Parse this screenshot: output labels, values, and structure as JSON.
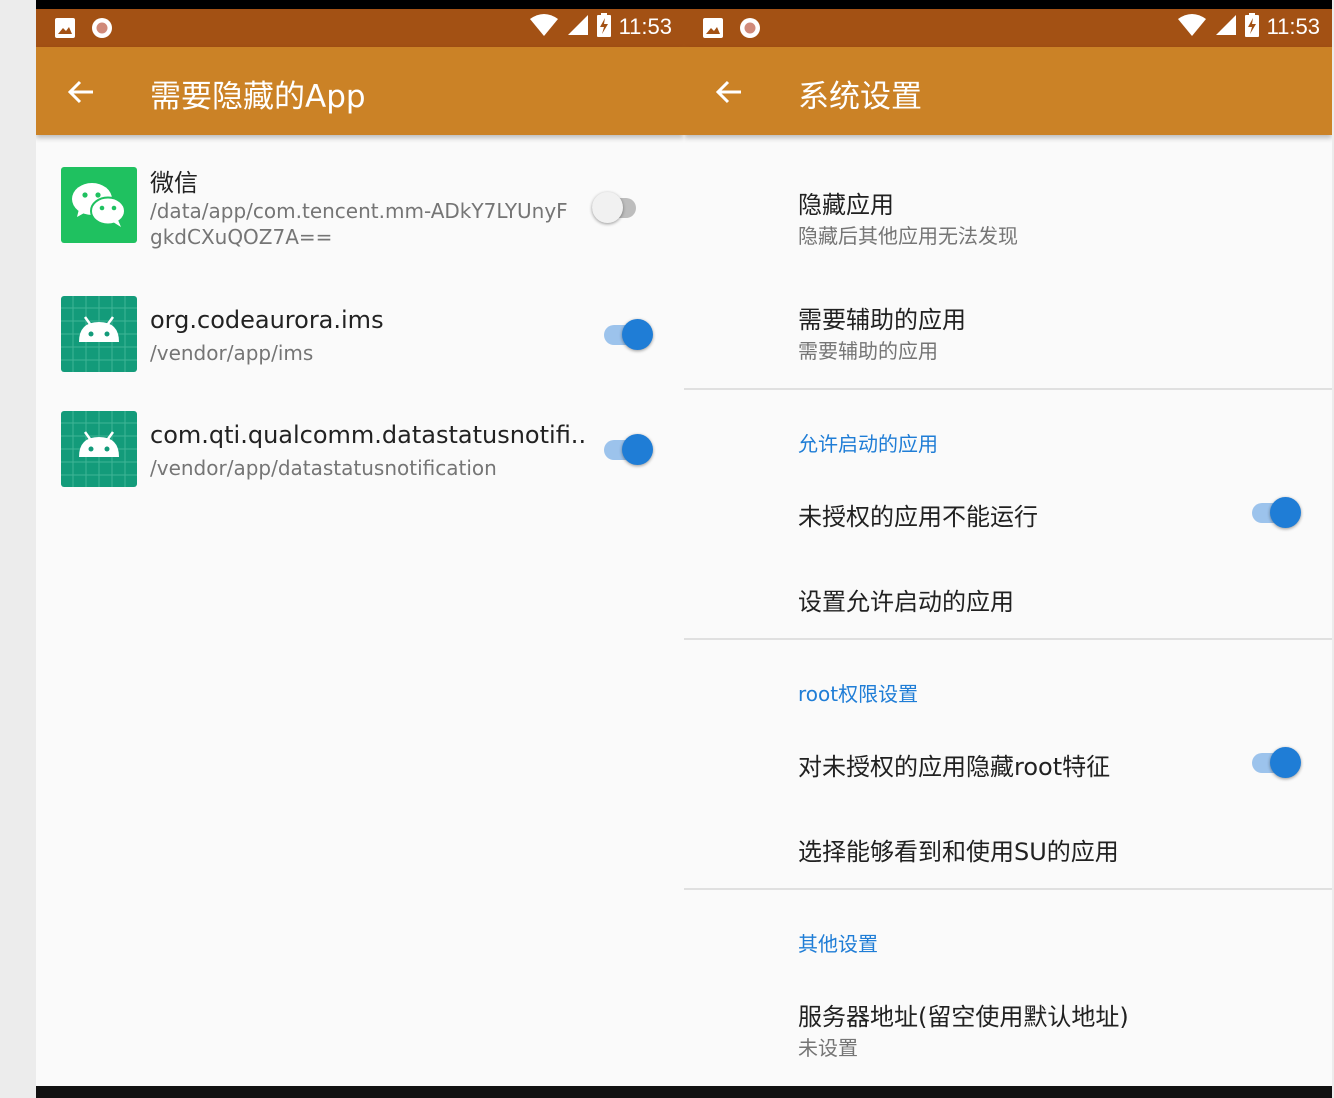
{
  "status_bar": {
    "time": "11:53"
  },
  "left_screen": {
    "title": "需要隐藏的App",
    "apps": [
      {
        "name": "微信",
        "path": "/data/app/com.tencent.mm-ADkY7LYUnyFgkdCXuQOZ7A==",
        "icon": "wechat-icon",
        "enabled": false
      },
      {
        "name": "org.codeaurora.ims",
        "path": "/vendor/app/ims",
        "icon": "android-icon",
        "enabled": true
      },
      {
        "name": "com.qti.qualcomm.datastatusnotifi..",
        "path": "/vendor/app/datastatusnotification",
        "icon": "android-icon",
        "enabled": true
      }
    ]
  },
  "right_screen": {
    "title": "系统设置",
    "prefs": {
      "hide_apps": {
        "title": "隐藏应用",
        "summary": "隐藏后其他应用无法发现"
      },
      "assist_apps": {
        "title": "需要辅助的应用",
        "summary": "需要辅助的应用"
      },
      "cat_launch": "允许启动的应用",
      "unauth_no_run": {
        "title": "未授权的应用不能运行",
        "enabled": true
      },
      "set_allowed": {
        "title": "设置允许启动的应用"
      },
      "cat_root": "root权限设置",
      "hide_root": {
        "title": "对未授权的应用隐藏root特征",
        "enabled": true
      },
      "choose_su": {
        "title": "选择能够看到和使用SU的应用"
      },
      "cat_other": "其他设置",
      "server": {
        "title": "服务器地址(留空使用默认地址)",
        "summary": "未设置"
      }
    }
  },
  "colors": {
    "status_bar": "#a35114",
    "app_bar": "#cb8226",
    "accent": "#1f7dd6",
    "wechat_green": "#1fc160",
    "android_teal": "#139b7a"
  }
}
